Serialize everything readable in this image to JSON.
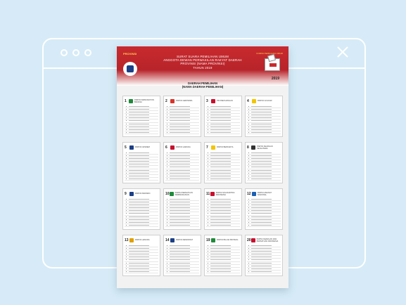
{
  "window": {
    "controls": [
      "dot",
      "dot",
      "dot"
    ],
    "close_icon": "close-icon"
  },
  "ballot": {
    "top_left_label": "PROVINSI",
    "top_right_label": "KOMISI PEMILIHAN UMUM",
    "title_lines": [
      "SURAT SUARA PEMILIHAN UMUM",
      "ANGGOTA DEWAN PERWAKILAN RAKYAT DAERAH",
      "PROVINSI (NAMA PROVINSI)",
      "TAHUN 2019"
    ],
    "region_lines": [
      "DAERAH PEMILIHAN",
      "(NAMA DAERAH PEMILIHAN)"
    ],
    "year_badge": "2019",
    "colors": {
      "header_red": "#c92a2e",
      "page_bg": "#d6ebf7"
    },
    "parties": [
      {
        "no": "1",
        "name": "PARTAI KEBANGKITAN BANGSA",
        "color": "#1f8a3a"
      },
      {
        "no": "2",
        "name": "PARTAI GERINDRA",
        "color": "#d8332a"
      },
      {
        "no": "3",
        "name": "PDI PERJUANGAN",
        "color": "#c8102e"
      },
      {
        "no": "4",
        "name": "PARTAI GOLKAR",
        "color": "#f2c500"
      },
      {
        "no": "5",
        "name": "PARTAI NASDEM",
        "color": "#1c3f86"
      },
      {
        "no": "6",
        "name": "PARTAI GARUDA",
        "color": "#c8102e"
      },
      {
        "no": "7",
        "name": "PARTAI BERKARYA",
        "color": "#f2c500"
      },
      {
        "no": "8",
        "name": "PARTAI KEADILAN SEJAHTERA",
        "color": "#333333"
      },
      {
        "no": "9",
        "name": "PARTAI PERINDO",
        "color": "#1c3f86"
      },
      {
        "no": "10",
        "name": "PARTAI PERSATUAN PEMBANGUNAN",
        "color": "#1f8a3a"
      },
      {
        "no": "11",
        "name": "PARTAI SOLIDARITAS INDONESIA",
        "color": "#c8102e"
      },
      {
        "no": "12",
        "name": "PARTAI AMANAT NASIONAL",
        "color": "#1c5fb3"
      },
      {
        "no": "13",
        "name": "PARTAI HANURA",
        "color": "#e0a000"
      },
      {
        "no": "14",
        "name": "PARTAI DEMOKRAT",
        "color": "#1c3f86"
      },
      {
        "no": "19",
        "name": "PARTAI BULAN BINTANG",
        "color": "#1f8a3a"
      },
      {
        "no": "20",
        "name": "PARTAI KEADILAN DAN PERSATUAN INDONESIA",
        "color": "#c8102e"
      }
    ],
    "candidate_rows_per_party": 10
  }
}
